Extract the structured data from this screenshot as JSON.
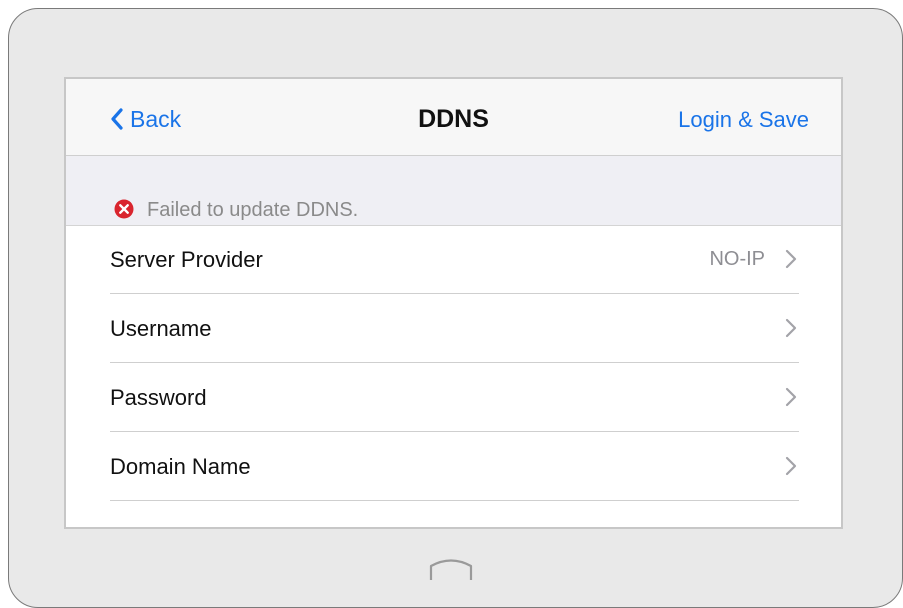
{
  "nav": {
    "back_label": "Back",
    "title": "DDNS",
    "action_label": "Login & Save"
  },
  "error": {
    "message": "Failed to update DDNS.",
    "color": "#d9252e"
  },
  "rows": [
    {
      "label": "Server Provider",
      "value": "NO-IP"
    },
    {
      "label": "Username",
      "value": ""
    },
    {
      "label": "Password",
      "value": ""
    },
    {
      "label": "Domain Name",
      "value": ""
    }
  ],
  "icons": {
    "back": "chevron-left-icon",
    "error": "error-circle-icon",
    "row": "chevron-right-icon",
    "home": "home-button-icon"
  },
  "colors": {
    "accent": "#1a74e8",
    "secondary_text": "#8e8e93"
  }
}
